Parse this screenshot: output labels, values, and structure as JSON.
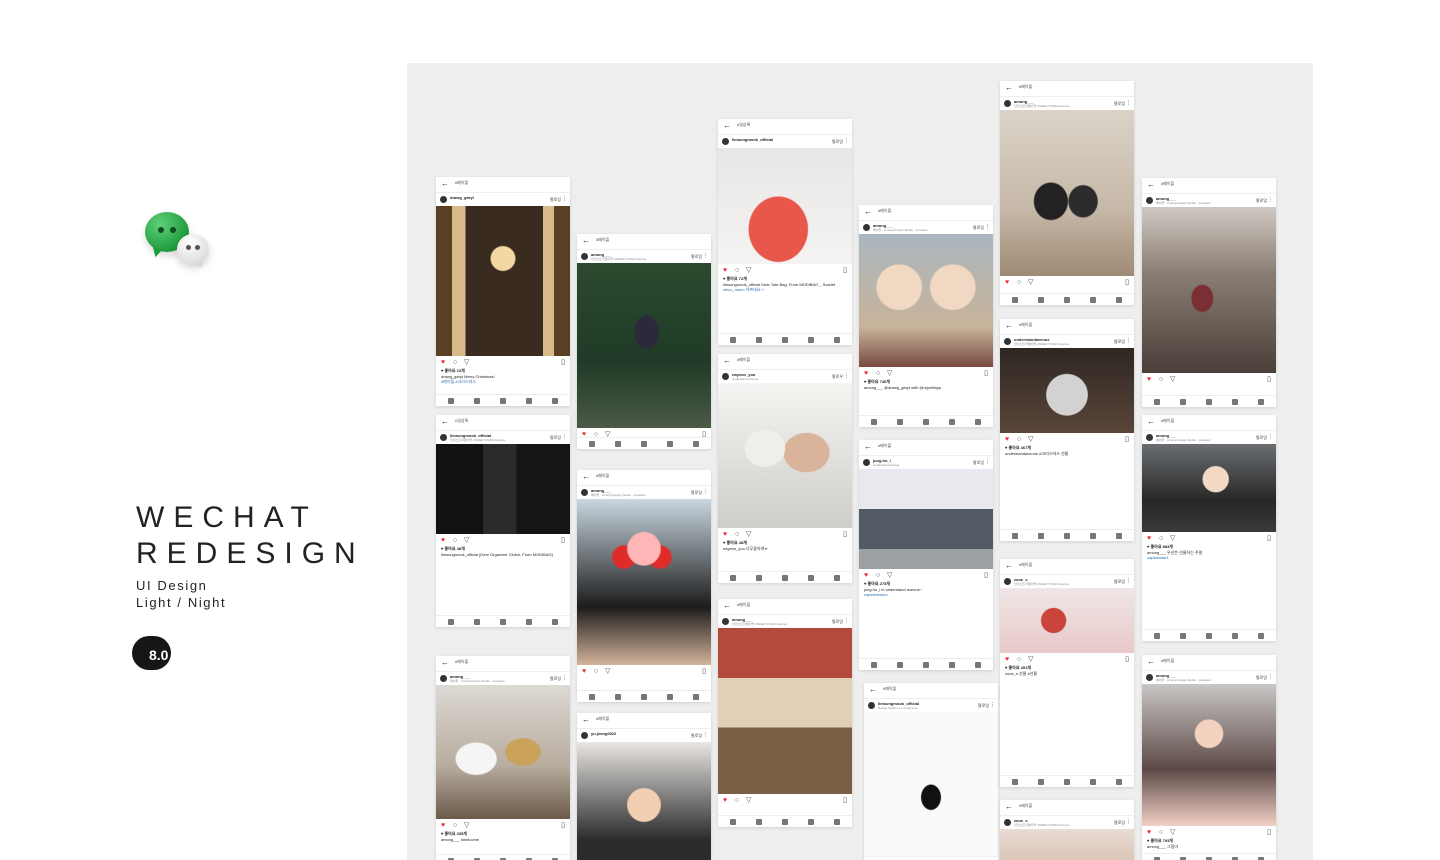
{
  "branding": {
    "title_line1": "WECHAT",
    "title_line2": "REDESIGN",
    "subtitle_line1": "UI Design",
    "subtitle_line2": "Light / Night",
    "version": "8.0",
    "logo_icon": "wechat-logo-icon",
    "brand_green": "#1f9a3c"
  },
  "showcase": {
    "background": "#eeeeee",
    "screens": [
      {
        "label": "#메이플",
        "user": "drawg_garyt",
        "sub": "",
        "follow": "팔로잉",
        "likes": "♥ 좋아요 23개",
        "caption": "drawg_garyt Merry Christmas!",
        "tags": "#메이플 #크리스마스"
      },
      {
        "label": "#일상록",
        "user": "limsungmook_official",
        "sub": "인더스트리얼아뜰 UNDER STAND Avenue",
        "follow": "팔로잉",
        "likes": "♥ 좋아요 48개",
        "caption": "limsungmook_official [Dear Organizer Clutch, From MODIBAG]",
        "tags": ""
      },
      {
        "label": "#메이플",
        "user": "among___",
        "sub": "메이플 · Among Design Studio · purseleiv",
        "follow": "팔로잉",
        "likes": "♥ 좋아요 335개",
        "caption": "among___ #welcome",
        "tags": ""
      },
      {
        "label": "#메이플",
        "user": "among___",
        "sub": "인더스트리얼아뜰 UNDER STAND Avenue",
        "follow": "팔로잉",
        "likes": "",
        "caption": "",
        "tags": ""
      },
      {
        "label": "#메이플",
        "user": "among___",
        "sub": "메이플 · Among Design Studio · purseleiv",
        "follow": "팔로잉",
        "likes": "",
        "caption": "",
        "tags": ""
      },
      {
        "label": "#메이플",
        "user": "yu.jeong0322",
        "sub": "",
        "follow": "팔로잉",
        "likes": "",
        "caption": "",
        "tags": ""
      },
      {
        "label": "#일상록",
        "user": "limsungmook_official",
        "sub": "",
        "follow": "팔로잉",
        "likes": "♥ 좋아요 72개",
        "caption": "limsungmook_official Dear Tote Bag, From MODIBAG _ Scarlet",
        "tags": "chico_mano 이쁘네요~!"
      },
      {
        "label": "#메이플",
        "user": "nayeon_yoo",
        "sub": "Understand Avenue",
        "follow": "팔로우",
        "likes": "♥ 좋아요 48개",
        "caption": "nayeon_yoo 너무좋아여ㅠ",
        "tags": ""
      },
      {
        "label": "#메이플",
        "user": "among___",
        "sub": "인더스트리얼아뜰 UNDER STAND Avenue",
        "follow": "팔로잉",
        "likes": "",
        "caption": "",
        "tags": ""
      },
      {
        "label": "#메이플",
        "user": "among___",
        "sub": "메이플 · Among Design Studio · purseleiv",
        "follow": "팔로잉",
        "likes": "♥ 좋아요 736개",
        "caption": "among___ @drawg_garyt with @rejoeflapp",
        "tags": ""
      },
      {
        "label": "#메이플",
        "user": "jung.ho_i",
        "sub": "Understand Avenue",
        "follow": "팔로잉",
        "likes": "♥ 좋아요 275개",
        "caption": "jung.ho_i in understand avenue~",
        "tags": "captainbokko"
      },
      {
        "label": "#메이플",
        "user": "limsungmook_official",
        "sub": "Design Studio Lim Sungmook",
        "follow": "팔로잉",
        "likes": "",
        "caption": "",
        "tags": ""
      },
      {
        "label": "#메이플",
        "user": "among___",
        "sub": "인더스트리얼아뜰 UNDER STAND Avenue",
        "follow": "팔로잉",
        "likes": "",
        "caption": "",
        "tags": ""
      },
      {
        "label": "#메이플",
        "user": "understandavenue",
        "sub": "인더스트리얼아뜰 UNDER STAND Avenue",
        "follow": "팔로잉",
        "likes": "♥ 좋아요 467개",
        "caption": "understandavenue #크리스마스 선물",
        "tags": ""
      },
      {
        "label": "#메이플",
        "user": "zooe_s",
        "sub": "인더스트리얼아뜰 UNDER STAND Avenue",
        "follow": "팔로잉",
        "likes": "♥ 좋아요 451개",
        "caption": "zooe_s 선물 #선물",
        "tags": ""
      },
      {
        "label": "#메이플",
        "user": "zooe_s",
        "sub": "인더스트리얼아뜰 UNDER STAND Avenue",
        "follow": "팔로잉",
        "likes": "",
        "caption": "",
        "tags": ""
      },
      {
        "label": "#메이플",
        "user": "among___",
        "sub": "메이플 · Among Design Studio · purseleiv",
        "follow": "팔로잉",
        "likes": "",
        "caption": "",
        "tags": ""
      },
      {
        "label": "#메이플",
        "user": "among___",
        "sub": "메이플 · Among Design Studio · purseleiv",
        "follow": "팔로잉",
        "likes": "♥ 좋아요 883개",
        "caption": "among___ 우산쓴 선물하는 주말",
        "tags": "captainstar1"
      },
      {
        "label": "#메이플",
        "user": "among___",
        "sub": "메이플 · Among Design Studio · purseleiv",
        "follow": "팔로잉",
        "likes": "♥ 좋아요 793개",
        "caption": "among___ 그림아",
        "tags": ""
      }
    ]
  }
}
